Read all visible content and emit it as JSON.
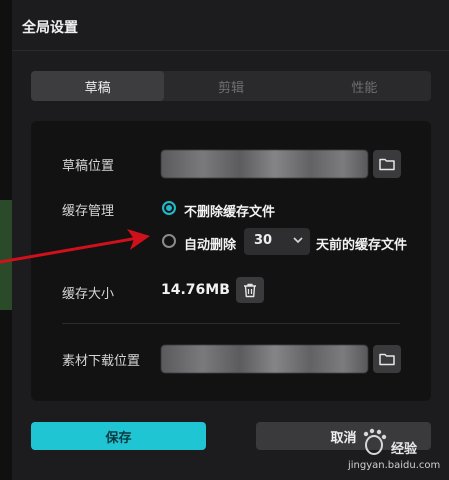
{
  "dialog": {
    "title": "全局设置"
  },
  "tabs": [
    {
      "label": "草稿",
      "active": true
    },
    {
      "label": "剪辑",
      "active": false
    },
    {
      "label": "性能",
      "active": false
    }
  ],
  "draft_location": {
    "label": "草稿位置"
  },
  "cache": {
    "label": "缓存管理",
    "option_keep": "不删除缓存文件",
    "option_auto": "自动删除",
    "days_value": "30",
    "days_suffix": "天前的缓存文件",
    "selected": "keep"
  },
  "cache_size": {
    "label": "缓存大小",
    "value": "14.76MB"
  },
  "material_location": {
    "label": "素材下载位置"
  },
  "buttons": {
    "save": "保存",
    "cancel": "取消"
  },
  "watermark": {
    "brand": "经验",
    "url": "jingyan.baidu.com"
  },
  "colors": {
    "accent": "#20c5d4",
    "annotation_arrow": "#d0101a"
  }
}
